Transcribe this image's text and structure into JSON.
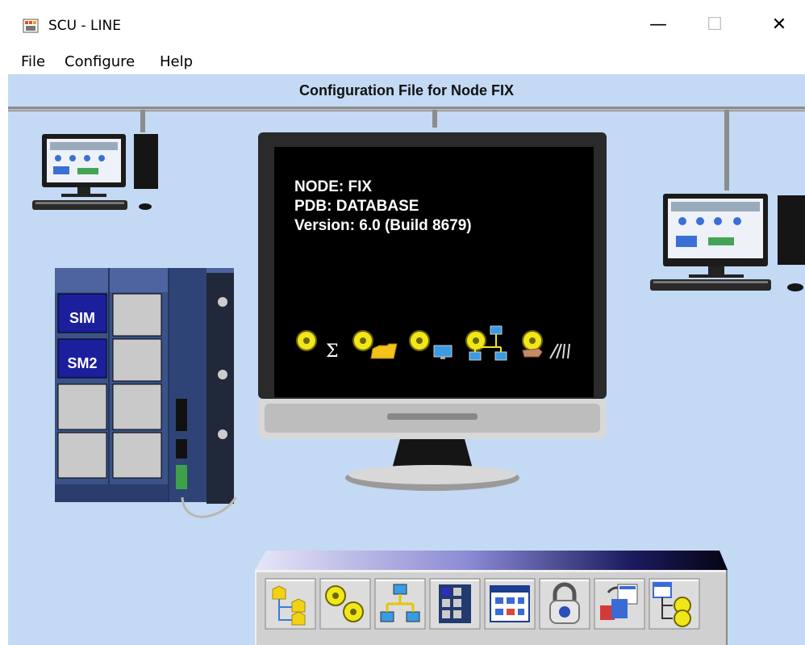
{
  "window": {
    "title": "SCU - LINE",
    "minimize_glyph": "—",
    "maximize_glyph": "☐",
    "close_glyph": "✕"
  },
  "menu": {
    "items": [
      "File",
      "Configure",
      "Help"
    ]
  },
  "main": {
    "heading": "Configuration File for Node FIX",
    "monitor": {
      "node_line": "NODE: FIX",
      "pdb_line": "PDB: DATABASE",
      "version_line": "Version:  6.0 (Build 8679)"
    },
    "rack": {
      "slot1": "SIM",
      "slot2": "SM2"
    },
    "screen_icons": {
      "sigma_symbol": "Σ"
    }
  },
  "toolbar": {
    "buttons": [
      "system-configuration-icon",
      "alarm-configuration-icon",
      "network-configuration-icon",
      "scada-configuration-icon",
      "sql-configuration-icon",
      "security-lock-icon",
      "language-translation-icon",
      "tag-group-icon"
    ]
  },
  "colors": {
    "canvas_bg": "#c3d9f4",
    "rack_blue": "#3a5287",
    "sim_slot": "#1c1f9c",
    "screen_bg": "#000000"
  }
}
